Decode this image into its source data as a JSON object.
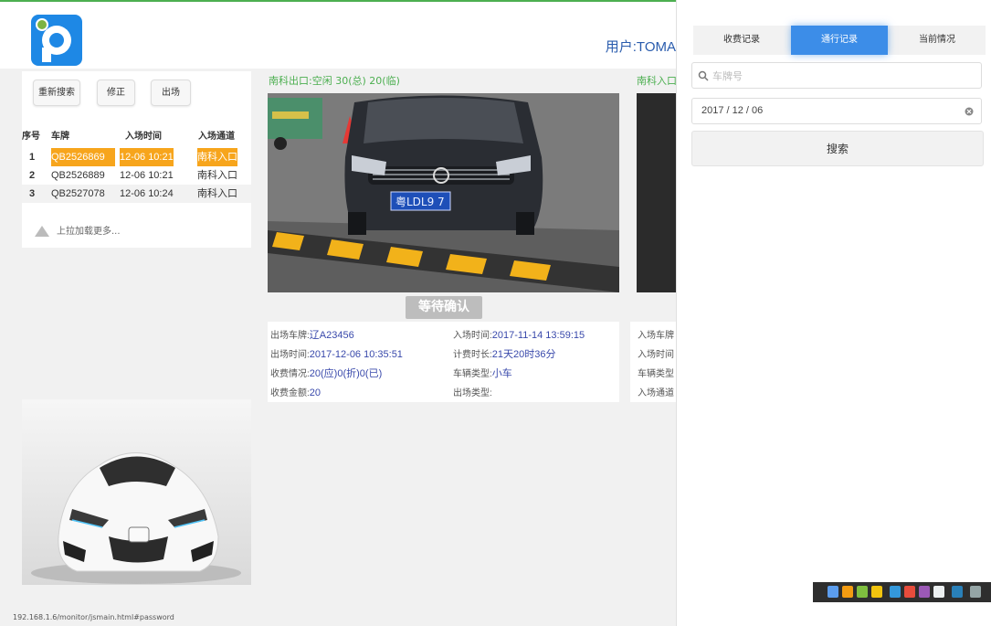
{
  "header": {
    "user_label": "用户:TOMA"
  },
  "toolbar": {
    "refresh_label": "重新搜索",
    "correct_label": "修正",
    "exit_label": "出场"
  },
  "table": {
    "headers": [
      "序号",
      "车牌",
      "入场时间",
      "入场通道"
    ],
    "rows": [
      {
        "index": "1",
        "plate": "QB2526869",
        "time": "12-06 10:21",
        "channel": "南科入口"
      },
      {
        "index": "2",
        "plate": "QB2526889",
        "time": "12-06 10:21",
        "channel": "南科入口"
      },
      {
        "index": "3",
        "plate": "QB2527078",
        "time": "12-06 10:24",
        "channel": "南科入口"
      }
    ],
    "load_more": "上拉加载更多..."
  },
  "exit_panel": {
    "title": "南科出口:空闲 30(总) 20(临)",
    "license_plate_photo": "粤LDL9 7",
    "wait_button": "等待确认",
    "info": {
      "exit_plate_label": "出场车牌:",
      "exit_plate": "辽A23456",
      "entry_time_label": "入场时间:",
      "entry_time": "2017-11-14 13:59:15",
      "exit_time_label": "出场时间:",
      "exit_time": "2017-12-06 10:35:51",
      "duration_label": "计费时长:",
      "duration": "21天20时36分",
      "fee_status_label": "收费情况:",
      "fee_status": "20(应)0(折)0(已)",
      "vehicle_type_label": "车辆类型:",
      "vehicle_type": "小车",
      "fee_amount_label": "收费金额:",
      "fee_amount": "20",
      "exit_type_label": "出场类型:",
      "exit_type": ""
    }
  },
  "entry_panel": {
    "title": "南科入口",
    "labels": [
      "入场车牌",
      "入场时间",
      "车辆类型",
      "入场通道"
    ]
  },
  "status_bar": {
    "url": "192.168.1.6/monitor/jsmain.html#password"
  },
  "right_panel": {
    "tabs": [
      {
        "label": "收费记录",
        "active": false
      },
      {
        "label": "通行记录",
        "active": true
      },
      {
        "label": "当前情况",
        "active": false
      }
    ],
    "plate_placeholder": "车牌号",
    "date_value": "2017 / 12 / 06",
    "search_label": "搜索"
  },
  "colors": {
    "accent_green": "#4caf50",
    "selection_orange": "#f7a51c",
    "active_tab_blue": "#3c8de8",
    "logo_blue": "#1e88e5",
    "value_blue": "#3949ab"
  }
}
